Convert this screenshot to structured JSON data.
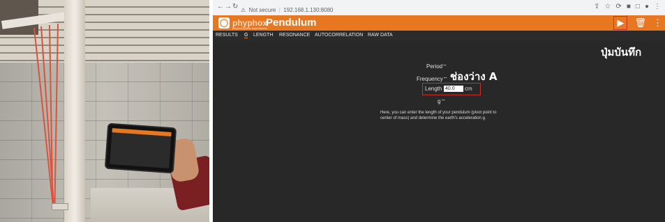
{
  "browser": {
    "security_label": "Not secure",
    "url": "192.168.1.130:8080"
  },
  "app": {
    "brand": "phyphox",
    "brand_subtitle": "physical phone experiments",
    "title": "Pendulum",
    "accent_color": "#e87722"
  },
  "tabs": [
    {
      "label": "RESULTS"
    },
    {
      "label": "G",
      "active": true
    },
    {
      "label": "LENGTH"
    },
    {
      "label": "RESONANCE"
    },
    {
      "label": "AUTOCORRELATION"
    },
    {
      "label": "RAW DATA"
    }
  ],
  "fields": {
    "period_label": "Period",
    "period_value": "–",
    "frequency_label": "Frequency",
    "frequency_value": "–",
    "length_label": "Length",
    "length_input_value": "40.0",
    "length_unit": "cm",
    "g_label": "g",
    "g_value": "–"
  },
  "description": "Here, you can enter the length of your pendulum (pivot point to center of mass) and determine the earth's acceleration g.",
  "annotations": {
    "record_button_label": "ปุ่มบันทึก",
    "field_label": "ช่องว่าง A"
  },
  "icons": {
    "play": "play-icon",
    "delete": "trash-icon",
    "menu": "more-vert-icon"
  }
}
